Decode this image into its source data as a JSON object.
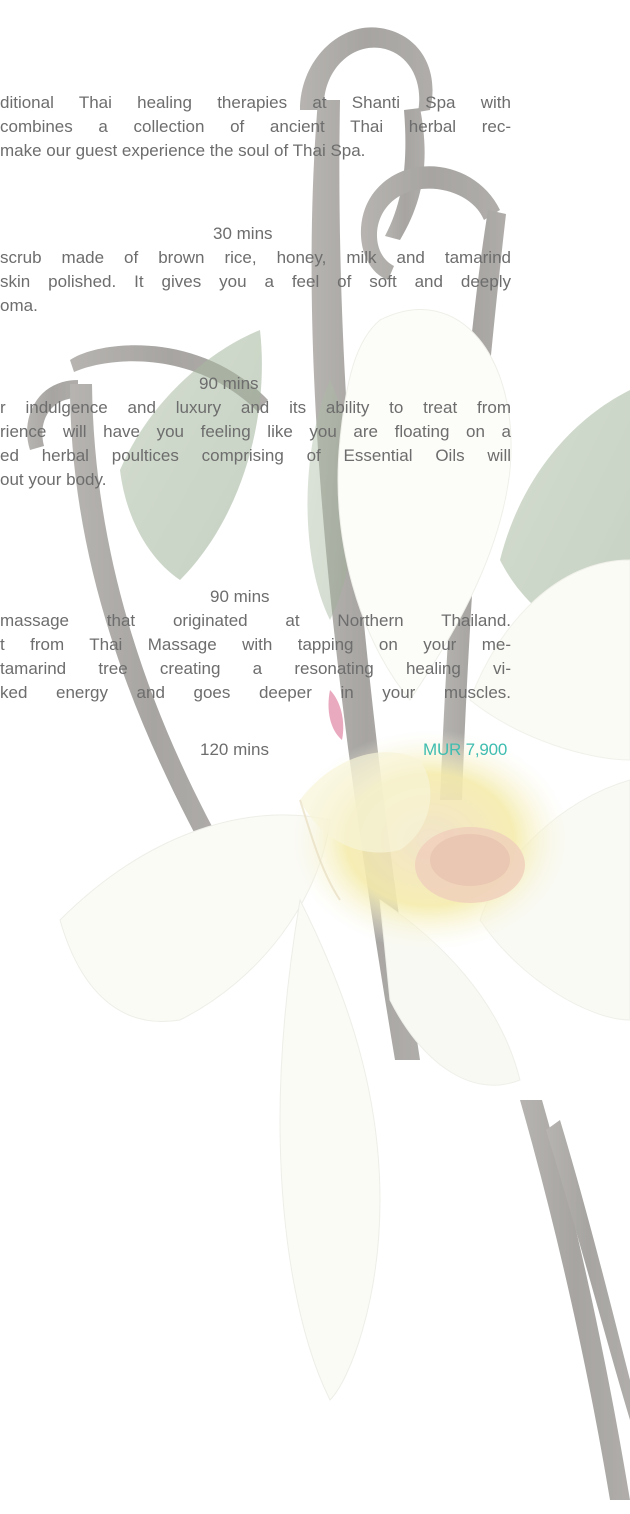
{
  "intro": {
    "lines": [
      "ditional Thai healing therapies at Shanti Spa with",
      "combines a collection of ancient Thai herbal rec-",
      "make our guest experience the soul of Thai Spa."
    ]
  },
  "treatments": [
    {
      "duration": "30 mins",
      "description_lines": [
        "scrub made of brown rice, honey, milk and tamarind",
        "skin polished. It gives you a feel of soft and deeply",
        "oma."
      ]
    },
    {
      "duration": "90 mins",
      "description_lines": [
        "r indulgence and luxury and its ability to treat from",
        "rience will have you feeling like you are floating on a",
        "ed herbal poultices comprising of Essential Oils will",
        "out your body."
      ]
    },
    {
      "duration": "90 mins",
      "description_lines": [
        "massage that originated at Northern Thailand.",
        "t from Thai Massage with tapping on your me-",
        "tamarind tree creating a resonating healing vi-",
        "ked energy and goes deeper in your muscles."
      ]
    },
    {
      "duration": "120 mins",
      "price": "MUR 7,900"
    }
  ],
  "colors": {
    "body_text": "#6d6d6d",
    "price_accent": "#3fbdb0",
    "background": "#ffffff"
  },
  "decoration": {
    "icon": "vanilla-orchid-illustration"
  }
}
